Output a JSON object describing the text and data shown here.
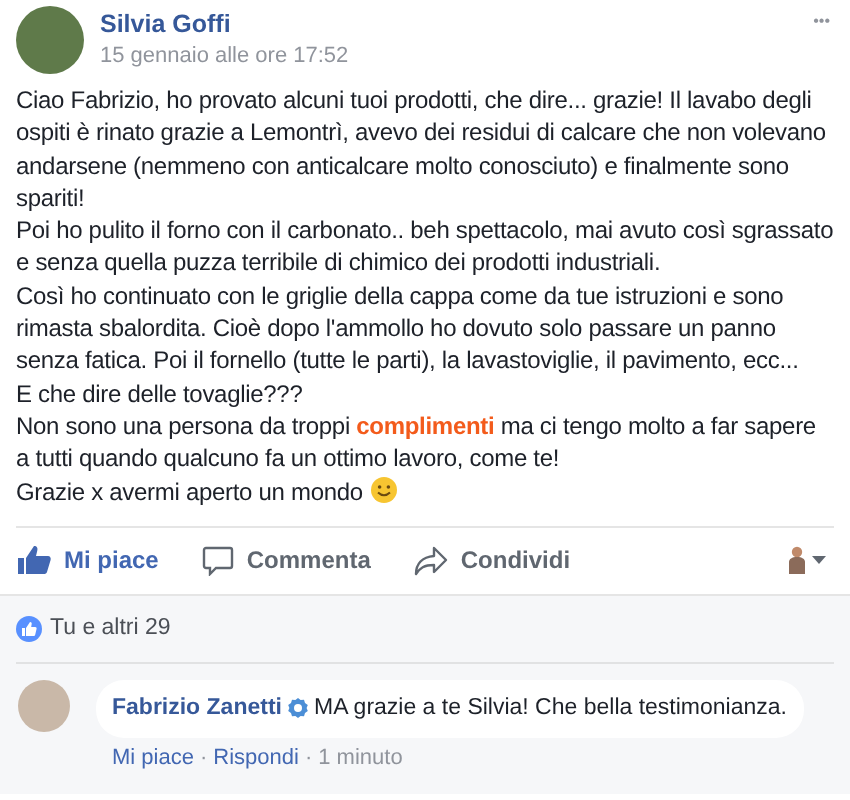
{
  "post": {
    "author": "Silvia Goffi",
    "time": "15 gennaio alle ore 17:52",
    "more": "•••",
    "paragraphs": [
      [
        {
          "text": "Ciao Fabrizio, ho provato alcuni tuoi prodotti, che dire... grazie! Il lavabo degli ospiti è rinato grazie a Lemontrì, avevo dei residui di calcare che non volevano andarsene (nemmeno con anticalcare molto conosciuto) e finalmente sono spariti!",
          "highlight": false
        }
      ],
      [
        {
          "text": "Poi ho pulito il forno con il carbonato.. beh spettacolo, mai avuto così sgrassato e senza quella puzza terribile di chimico dei prodotti industriali.",
          "highlight": false
        }
      ],
      [
        {
          "text": "Così ho continuato con le griglie della cappa come da tue istruzioni e sono rimasta sbalordita. Cioè dopo l'ammollo ho dovuto solo passare un panno senza fatica. Poi il fornello (tutte le parti), la lavastoviglie, il pavimento, ecc...",
          "highlight": false
        }
      ],
      [
        {
          "text": "E che dire delle tovaglie???",
          "highlight": false
        }
      ],
      [
        {
          "text": "Non sono una persona da troppi ",
          "highlight": false
        },
        {
          "text": "complimenti",
          "highlight": true
        },
        {
          "text": " ma ci tengo molto a far sapere a tutti quando qualcuno fa un ottimo lavoro, come te!",
          "highlight": false
        }
      ],
      [
        {
          "text": "Grazie x avermi aperto un mondo",
          "highlight": false,
          "emoji": true
        }
      ]
    ]
  },
  "actions": [
    {
      "kind": "like",
      "label": "Mi piace",
      "selected": true
    },
    {
      "kind": "comment",
      "label": "Commenta",
      "selected": false
    },
    {
      "kind": "share",
      "label": "Condividi",
      "selected": false
    }
  ],
  "reactions": {
    "label": "Tu e altri 29"
  },
  "comment": {
    "author": "Fabrizio Zanetti",
    "text": "MA grazie a te Silvia! Che bella testimonianza.",
    "like": "Mi piace",
    "reply": "Rispondi",
    "time": "1 minuto",
    "separator": "·"
  }
}
